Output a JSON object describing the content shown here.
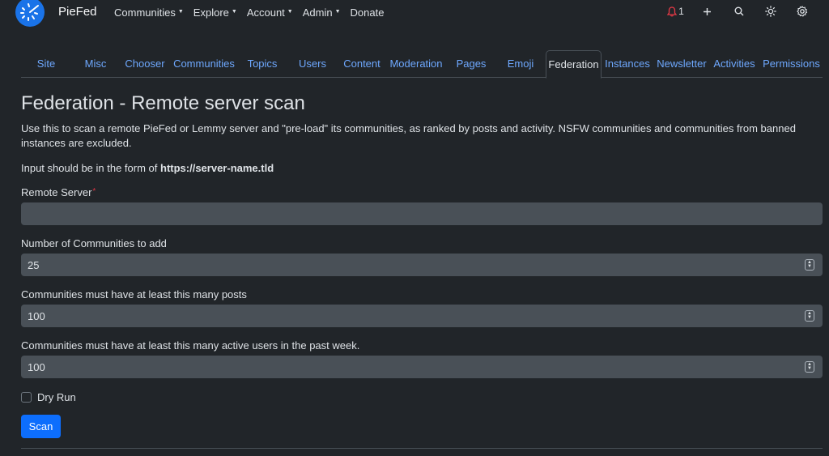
{
  "brand": {
    "name": "PieFed",
    "accent": "#1a73e8"
  },
  "nav": {
    "items": [
      {
        "label": "Communities",
        "dropdown": true
      },
      {
        "label": "Explore",
        "dropdown": true
      },
      {
        "label": "Account",
        "dropdown": true
      },
      {
        "label": "Admin",
        "dropdown": true
      },
      {
        "label": "Donate",
        "dropdown": false
      }
    ],
    "notifications_count": "1",
    "icons": [
      "bell-icon",
      "plus-icon",
      "search-icon",
      "sun-icon",
      "gear-icon"
    ]
  },
  "tabs": [
    {
      "label": "Site"
    },
    {
      "label": "Misc"
    },
    {
      "label": "Chooser"
    },
    {
      "label": "Communities"
    },
    {
      "label": "Topics"
    },
    {
      "label": "Users"
    },
    {
      "label": "Content"
    },
    {
      "label": "Moderation"
    },
    {
      "label": "Pages"
    },
    {
      "label": "Emoji"
    },
    {
      "label": "Federation",
      "active": true
    },
    {
      "label": "Instances"
    },
    {
      "label": "Newsletter"
    },
    {
      "label": "Activities"
    },
    {
      "label": "Permissions"
    }
  ],
  "page": {
    "title": "Federation - Remote server scan",
    "description": "Use this to scan a remote PieFed or Lemmy server and \"pre-load\" its communities, as ranked by posts and activity. NSFW communities and communities from banned instances are excluded.",
    "hint_prefix": "Input should be in the form of ",
    "hint_example": "https://server-name.tld"
  },
  "form": {
    "remote_server": {
      "label": "Remote Server",
      "required_mark": "*",
      "value": ""
    },
    "num_communities": {
      "label": "Number of Communities to add",
      "value": "25"
    },
    "min_posts": {
      "label": "Communities must have at least this many posts",
      "value": "100"
    },
    "min_active_users": {
      "label": "Communities must have at least this many active users in the past week.",
      "value": "100"
    },
    "dry_run": {
      "label": "Dry Run",
      "checked": false
    },
    "submit_label": "Scan"
  }
}
